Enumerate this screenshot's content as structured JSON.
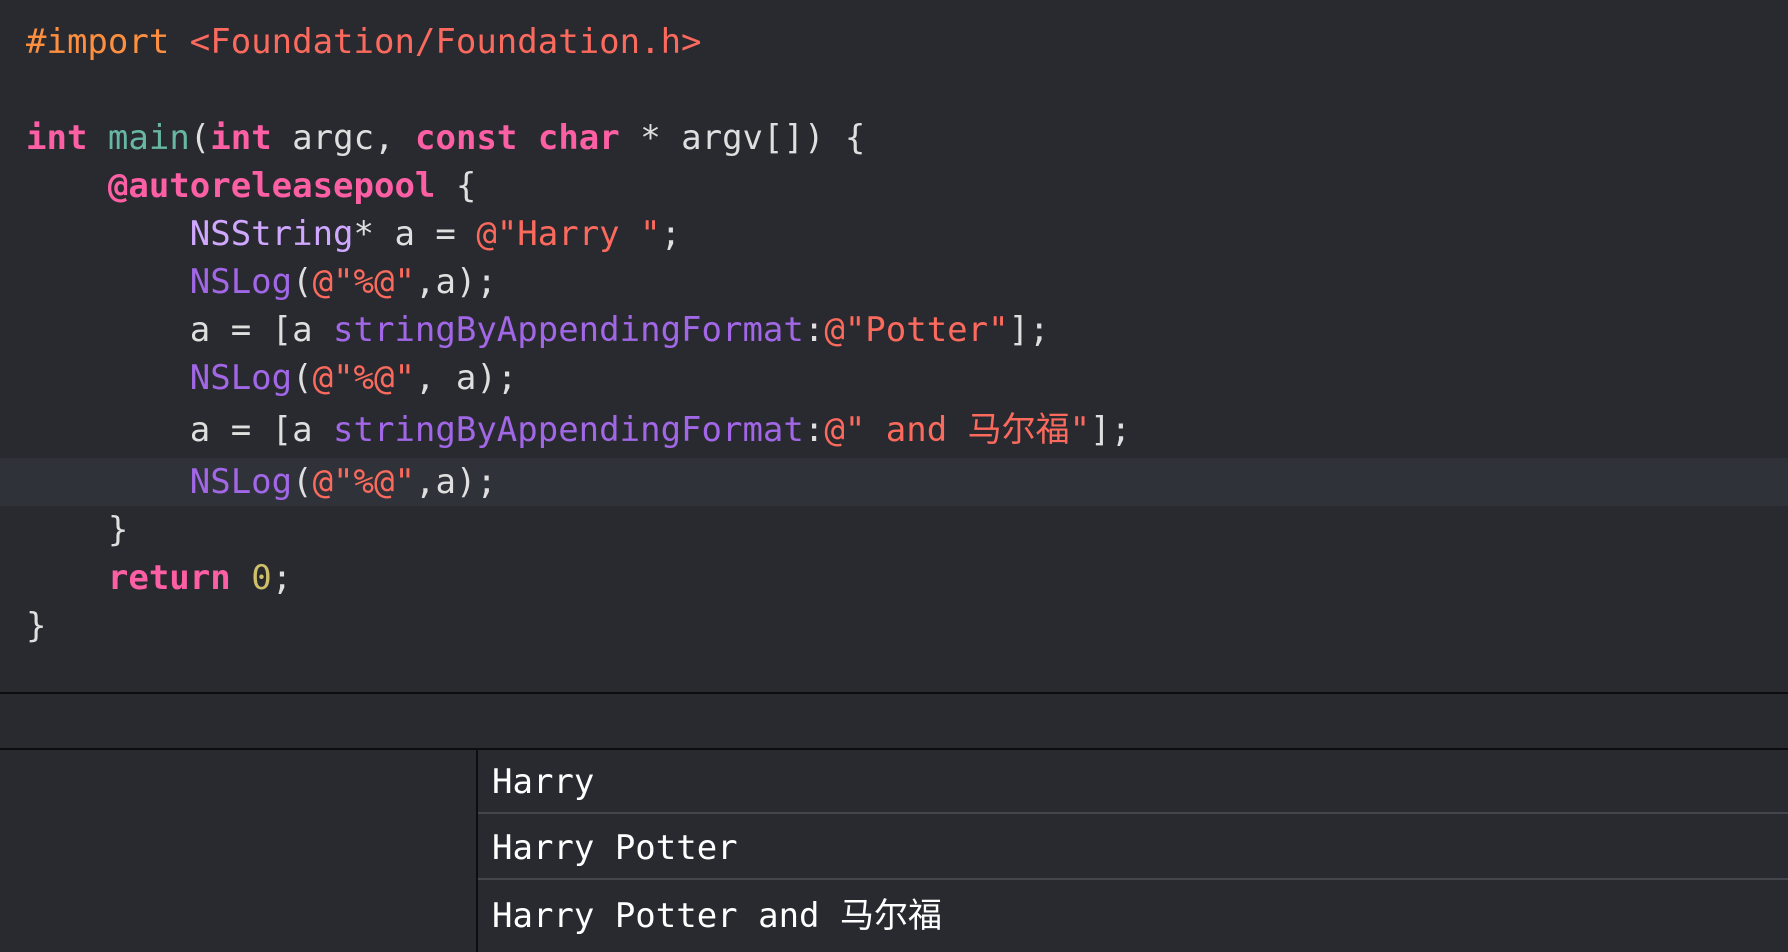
{
  "editor": {
    "lines": [
      [
        [
          "#import ",
          "pre"
        ],
        [
          "<Foundation/Foundation.h>",
          "str"
        ]
      ],
      [],
      [
        [
          "int",
          "kw"
        ],
        [
          " ",
          "id"
        ],
        [
          "main",
          "fn"
        ],
        [
          "(",
          "id"
        ],
        [
          "int",
          "kw"
        ],
        [
          " argc, ",
          "id"
        ],
        [
          "const",
          "kw"
        ],
        [
          " ",
          "id"
        ],
        [
          "char",
          "kw"
        ],
        [
          " * argv[]) {",
          "id"
        ]
      ],
      [
        [
          "    ",
          "id"
        ],
        [
          "@autoreleasepool",
          "kw"
        ],
        [
          " {",
          "id"
        ]
      ],
      [
        [
          "        ",
          "id"
        ],
        [
          "NSString",
          "cls"
        ],
        [
          "* a = ",
          "id"
        ],
        [
          "@\"Harry \"",
          "str"
        ],
        [
          ";",
          "id"
        ]
      ],
      [
        [
          "        ",
          "id"
        ],
        [
          "NSLog",
          "meth"
        ],
        [
          "(",
          "id"
        ],
        [
          "@\"%@\"",
          "str"
        ],
        [
          ",a);",
          "id"
        ]
      ],
      [
        [
          "        a = [a ",
          "id"
        ],
        [
          "stringByAppendingFormat",
          "meth"
        ],
        [
          ":",
          "id"
        ],
        [
          "@\"Potter\"",
          "str"
        ],
        [
          "];",
          "id"
        ]
      ],
      [
        [
          "        ",
          "id"
        ],
        [
          "NSLog",
          "meth"
        ],
        [
          "(",
          "id"
        ],
        [
          "@\"%@\"",
          "str"
        ],
        [
          ", a);",
          "id"
        ]
      ],
      [
        [
          "        a = [a ",
          "id"
        ],
        [
          "stringByAppendingFormat",
          "meth"
        ],
        [
          ":",
          "id"
        ],
        [
          "@\" and 马尔福\"",
          "str"
        ],
        [
          "];",
          "id"
        ]
      ],
      [
        [
          "        ",
          "id"
        ],
        [
          "NSLog",
          "meth"
        ],
        [
          "(",
          "id"
        ],
        [
          "@\"%@\"",
          "str"
        ],
        [
          ",a);",
          "id"
        ]
      ],
      [
        [
          "    }",
          "id"
        ]
      ],
      [
        [
          "    ",
          "id"
        ],
        [
          "return",
          "kw"
        ],
        [
          " ",
          "id"
        ],
        [
          "0",
          "num"
        ],
        [
          ";",
          "id"
        ]
      ],
      [
        [
          "}",
          "id"
        ]
      ]
    ],
    "current_line_index": 9
  },
  "console": {
    "outputs": [
      "Harry",
      "Harry Potter",
      "Harry Potter and 马尔福"
    ]
  }
}
